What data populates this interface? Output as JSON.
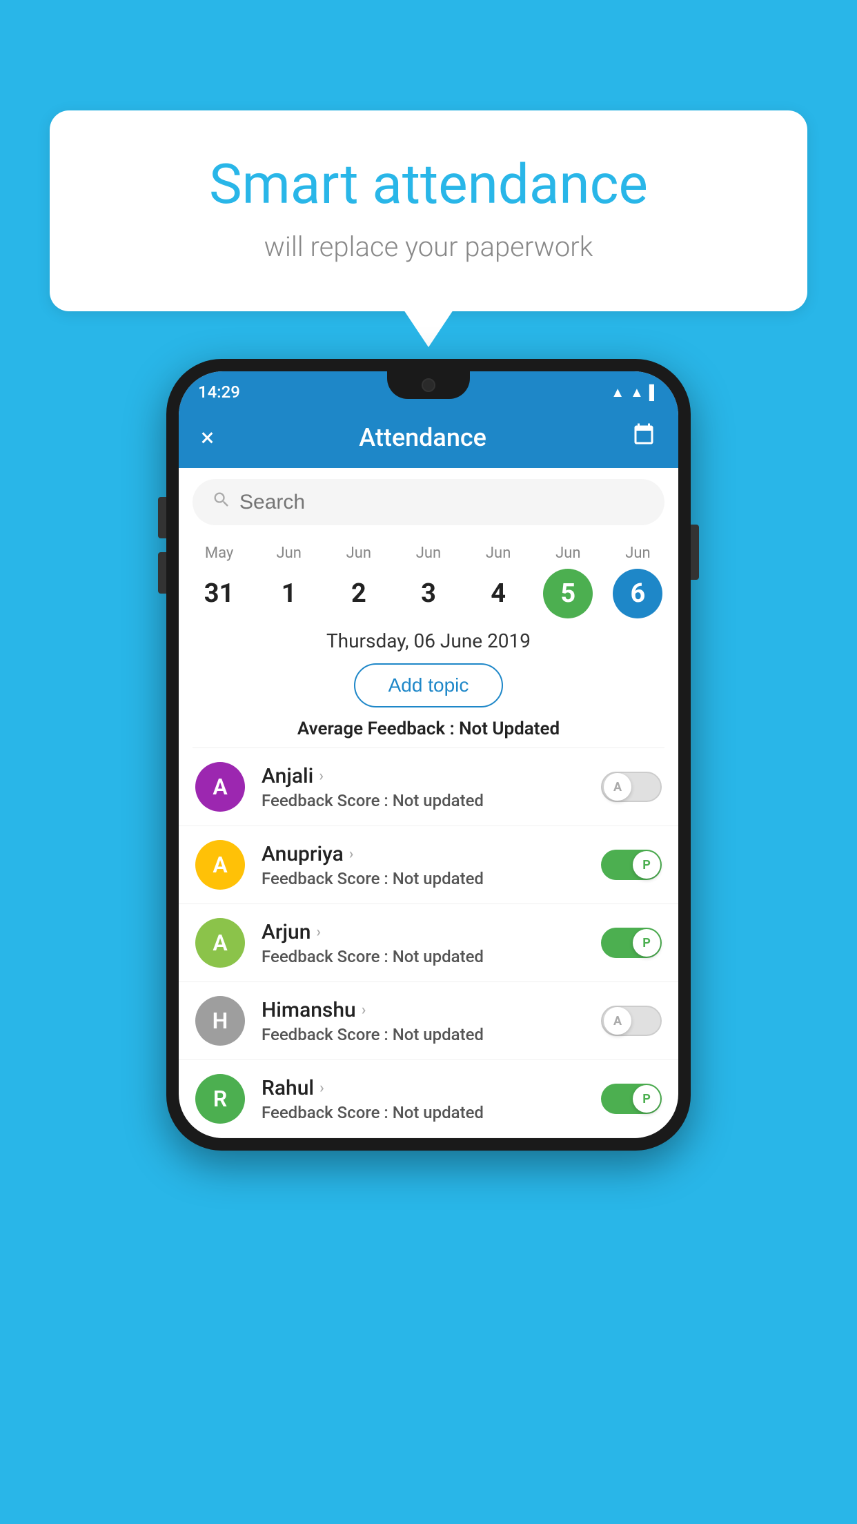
{
  "background_color": "#29b6e8",
  "bubble": {
    "title": "Smart attendance",
    "subtitle": "will replace your paperwork"
  },
  "app": {
    "status_time": "14:29",
    "title": "Attendance",
    "close_label": "×",
    "calendar_icon": "📅"
  },
  "search": {
    "placeholder": "Search"
  },
  "calendar": {
    "days": [
      {
        "month": "May",
        "num": "31",
        "style": "normal"
      },
      {
        "month": "Jun",
        "num": "1",
        "style": "normal"
      },
      {
        "month": "Jun",
        "num": "2",
        "style": "normal"
      },
      {
        "month": "Jun",
        "num": "3",
        "style": "normal"
      },
      {
        "month": "Jun",
        "num": "4",
        "style": "normal"
      },
      {
        "month": "Jun",
        "num": "5",
        "style": "green"
      },
      {
        "month": "Jun",
        "num": "6",
        "style": "blue"
      }
    ],
    "selected_date": "Thursday, 06 June 2019"
  },
  "add_topic_label": "Add topic",
  "avg_feedback_label": "Average Feedback :",
  "avg_feedback_value": "Not Updated",
  "students": [
    {
      "name": "Anjali",
      "avatar_letter": "A",
      "avatar_color": "#9c27b0",
      "score_label": "Feedback Score :",
      "score_value": "Not updated",
      "toggle": "off",
      "toggle_letter": "A"
    },
    {
      "name": "Anupriya",
      "avatar_letter": "A",
      "avatar_color": "#ffc107",
      "score_label": "Feedback Score :",
      "score_value": "Not updated",
      "toggle": "on",
      "toggle_letter": "P"
    },
    {
      "name": "Arjun",
      "avatar_letter": "A",
      "avatar_color": "#8bc34a",
      "score_label": "Feedback Score :",
      "score_value": "Not updated",
      "toggle": "on",
      "toggle_letter": "P"
    },
    {
      "name": "Himanshu",
      "avatar_letter": "H",
      "avatar_color": "#9e9e9e",
      "score_label": "Feedback Score :",
      "score_value": "Not updated",
      "toggle": "off",
      "toggle_letter": "A"
    },
    {
      "name": "Rahul",
      "avatar_letter": "R",
      "avatar_color": "#4caf50",
      "score_label": "Feedback Score :",
      "score_value": "Not updated",
      "toggle": "on",
      "toggle_letter": "P"
    }
  ]
}
